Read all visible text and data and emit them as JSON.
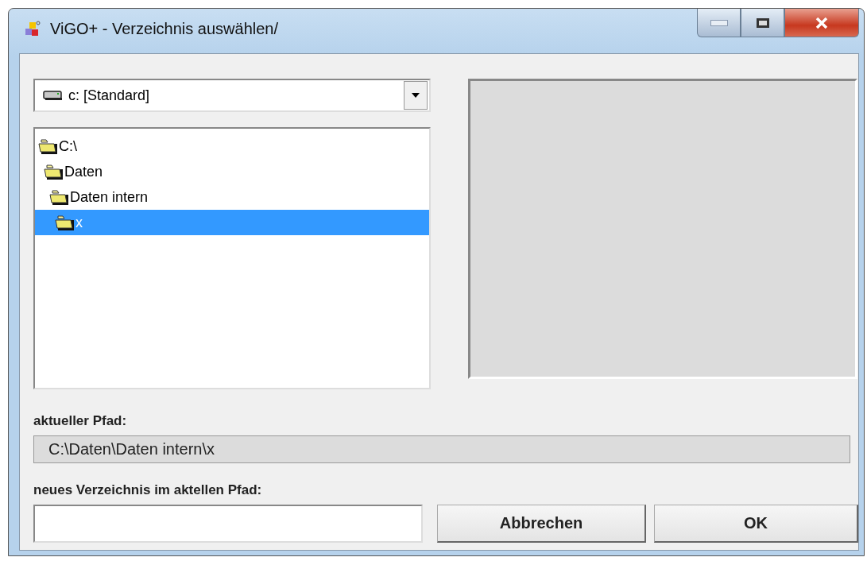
{
  "window": {
    "title": "ViGO+ - Verzeichnis auswählen/"
  },
  "drive_select": {
    "value": "c: [Standard]"
  },
  "folder_tree": [
    {
      "label": "C:\\",
      "selected": false,
      "children": [
        {
          "label": "Daten",
          "selected": false,
          "children": [
            {
              "label": "Daten intern",
              "selected": false,
              "children": [
                {
                  "label": "x",
                  "selected": true
                }
              ]
            }
          ]
        }
      ]
    }
  ],
  "current_path": {
    "label": "aktueller Pfad:",
    "value": "C:\\Daten\\Daten intern\\x"
  },
  "new_folder": {
    "label": "neues Verzeichnis im aktellen Pfad:"
  },
  "buttons": [
    {
      "label": "Abbrechen"
    },
    {
      "label": "OK"
    }
  ]
}
